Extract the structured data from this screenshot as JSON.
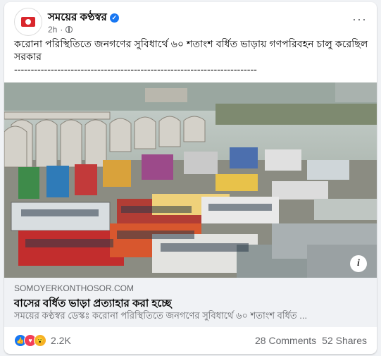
{
  "post": {
    "page_name": "সময়ের কণ্ঠস্বর",
    "verified_icon": "verified-badge-icon",
    "time": "2h",
    "visibility_icon": "globe-icon",
    "more_label": "···",
    "text_line": "করোনা পরিস্থিতিতে জনগণের সুবিধার্থে ৬০ শতাংশ বর্ধিত ভাড়ায় গণপরিবহন চালু করেছিল সরকার",
    "divider_line": "-------------------------------------------------------------------------"
  },
  "link": {
    "domain": "SOMOYERKONTHOSOR.COM",
    "title": "বাসের বর্ধিত ভাড়া প্রত্যাহার করা হচ্ছে",
    "description": "সময়ের কণ্ঠস্বর ডেস্কঃ করোনা পরিস্থিতিতে জনগণের সুবিধার্থে ৬০ শতাংশ বর্ধিত ...",
    "info_label": "i"
  },
  "stats": {
    "reactions_count": "2.2K",
    "reaction_icons": [
      "like-icon",
      "love-icon",
      "wow-icon"
    ],
    "comments": "28 Comments",
    "shares": "52 Shares"
  },
  "colors": {
    "accent": "#1877f2",
    "love": "#f33e58",
    "wow": "#f7b125",
    "secondary_text": "#65676b"
  }
}
